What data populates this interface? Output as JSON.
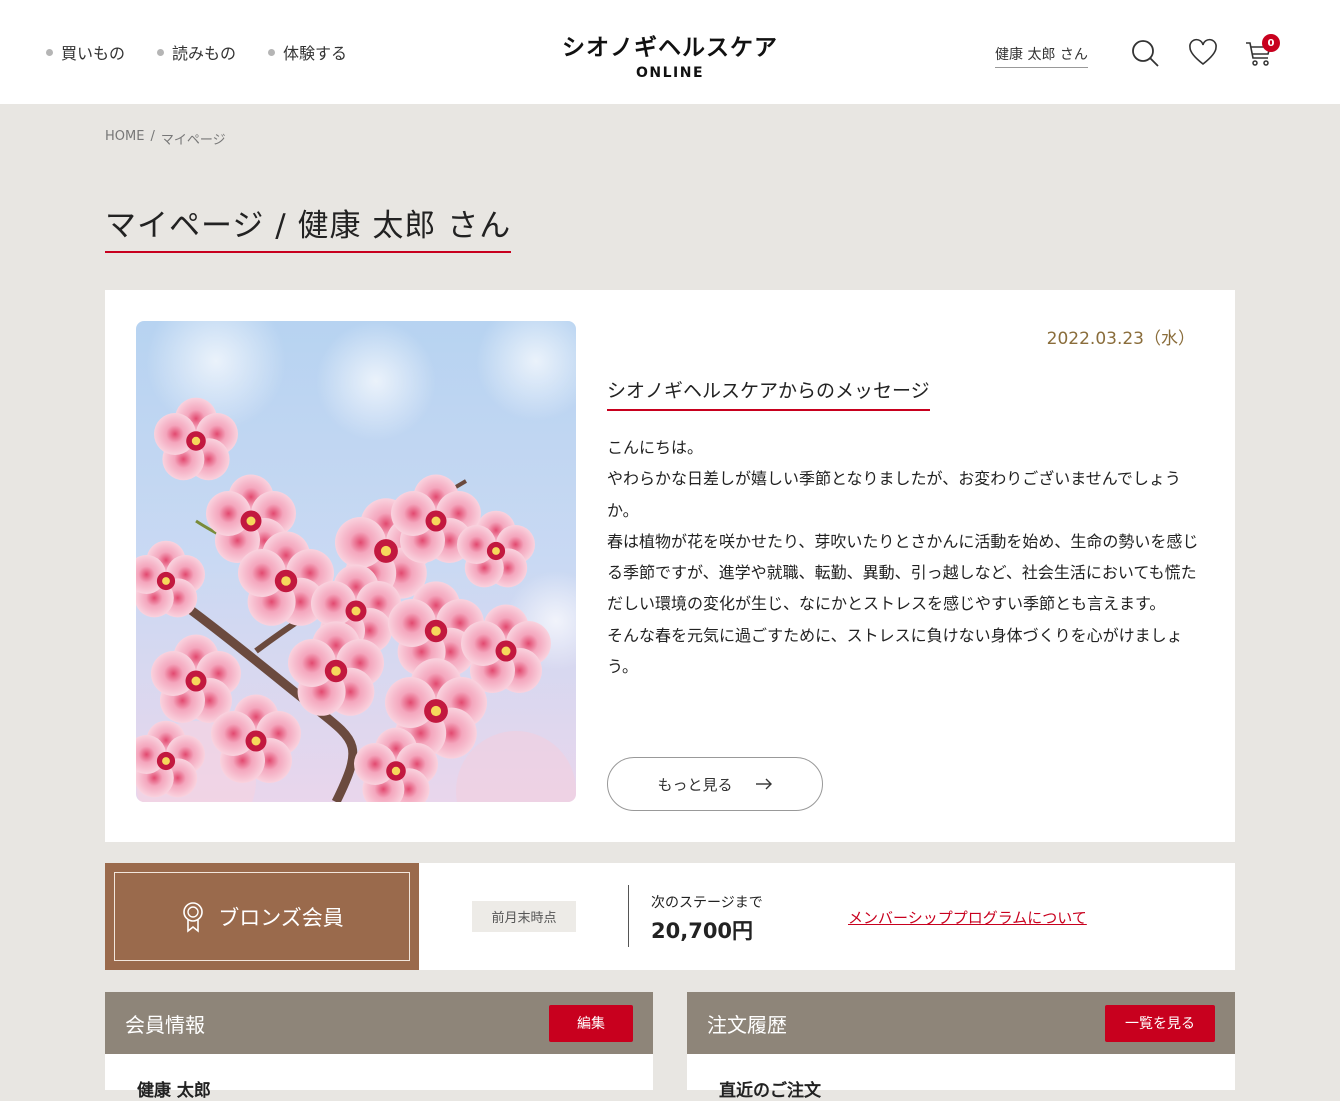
{
  "header": {
    "nav": [
      "買いもの",
      "読みもの",
      "体験する"
    ],
    "logo_main": "シオノギヘルスケア",
    "logo_sub": "ONLINE",
    "user_name": "健康 太郎 さん",
    "cart_count": "0",
    "icons": [
      "search-icon",
      "heart-icon",
      "cart-icon"
    ]
  },
  "breadcrumb": {
    "home": "HOME",
    "sep": "/",
    "current": "マイページ"
  },
  "page_title": "マイページ / 健康 太郎 さん",
  "message": {
    "date": "2022.03.23（水）",
    "title": "シオノギヘルスケアからのメッセージ",
    "lines": [
      "こんにちは。",
      "やわらかな日差しが嬉しい季節となりましたが、お変わりございませんでしょうか。",
      "春は植物が花を咲かせたり、芽吹いたりとさかんに活動を始め、生命の勢いを感じる季節ですが、進学や就職、転勤、異動、引っ越しなど、社会生活においても慌ただしい環境の変化が生じ、なにかとストレスを感じやすい季節とも言えます。",
      "そんな春を元気に過ごすために、ストレスに負けない身体づくりを心がけましょう。"
    ],
    "more_label": "もっと見る"
  },
  "membership": {
    "rank": "ブロンズ会員",
    "as_of": "前月末時点",
    "next_label": "次のステージまで",
    "next_amount": "20,700円",
    "program_link": "メンバーシッププログラムについて"
  },
  "panels": {
    "member_info": {
      "title": "会員情報",
      "button": "編集",
      "first_line": "健康 太郎"
    },
    "order_history": {
      "title": "注文履歴",
      "button": "一覧を見る",
      "first_line": "直近のご注文"
    }
  },
  "colors": {
    "accent": "#c8001e",
    "bronze": "#9a6a4c",
    "panel_head": "#8e8579",
    "background": "#e8e6e2"
  }
}
